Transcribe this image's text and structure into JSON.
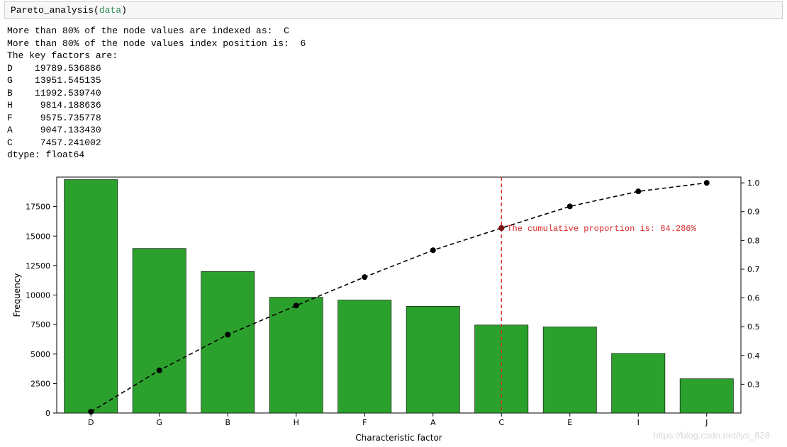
{
  "code_cell": {
    "function_name": "Pareto_analysis",
    "argument": "data"
  },
  "output": {
    "line1": "More than 80% of the node values are indexed as:  C",
    "line2": "More than 80% of the node values index position is:  6",
    "line3": "The key factors are:",
    "factors": [
      {
        "label": "D",
        "value": "19789.536886"
      },
      {
        "label": "G",
        "value": "13951.545135"
      },
      {
        "label": "B",
        "value": "11992.539740"
      },
      {
        "label": "H",
        "value": " 9814.188636"
      },
      {
        "label": "F",
        "value": " 9575.735778"
      },
      {
        "label": "A",
        "value": " 9047.133430"
      },
      {
        "label": "C",
        "value": " 7457.241002"
      }
    ],
    "dtype": "dtype: float64"
  },
  "chart_data": {
    "type": "bar",
    "categories": [
      "D",
      "G",
      "B",
      "H",
      "F",
      "A",
      "C",
      "E",
      "I",
      "J"
    ],
    "values": [
      19789.54,
      13951.55,
      11992.54,
      9814.19,
      9575.74,
      9047.13,
      7457.24,
      7300,
      5050,
      2900
    ],
    "cumulative_proportion": [
      0.2043,
      0.3484,
      0.4722,
      0.5735,
      0.6724,
      0.7658,
      0.8428,
      0.9182,
      0.9703,
      1.0
    ],
    "xlabel": "Characteristic factor",
    "ylabel": "Frequency",
    "y_ticks": [
      0,
      2500,
      5000,
      7500,
      10000,
      12500,
      15000,
      17500
    ],
    "y2_ticks": [
      0.3,
      0.4,
      0.5,
      0.6,
      0.7,
      0.8,
      0.9,
      1.0
    ],
    "ylim": [
      0,
      20000
    ],
    "y2lim": [
      0.2,
      1.02
    ],
    "annotation_index": 6,
    "annotation_text": "The cumulative proportion is: 84.286%"
  },
  "watermark": "https://blog.csdn.net/lys_828"
}
